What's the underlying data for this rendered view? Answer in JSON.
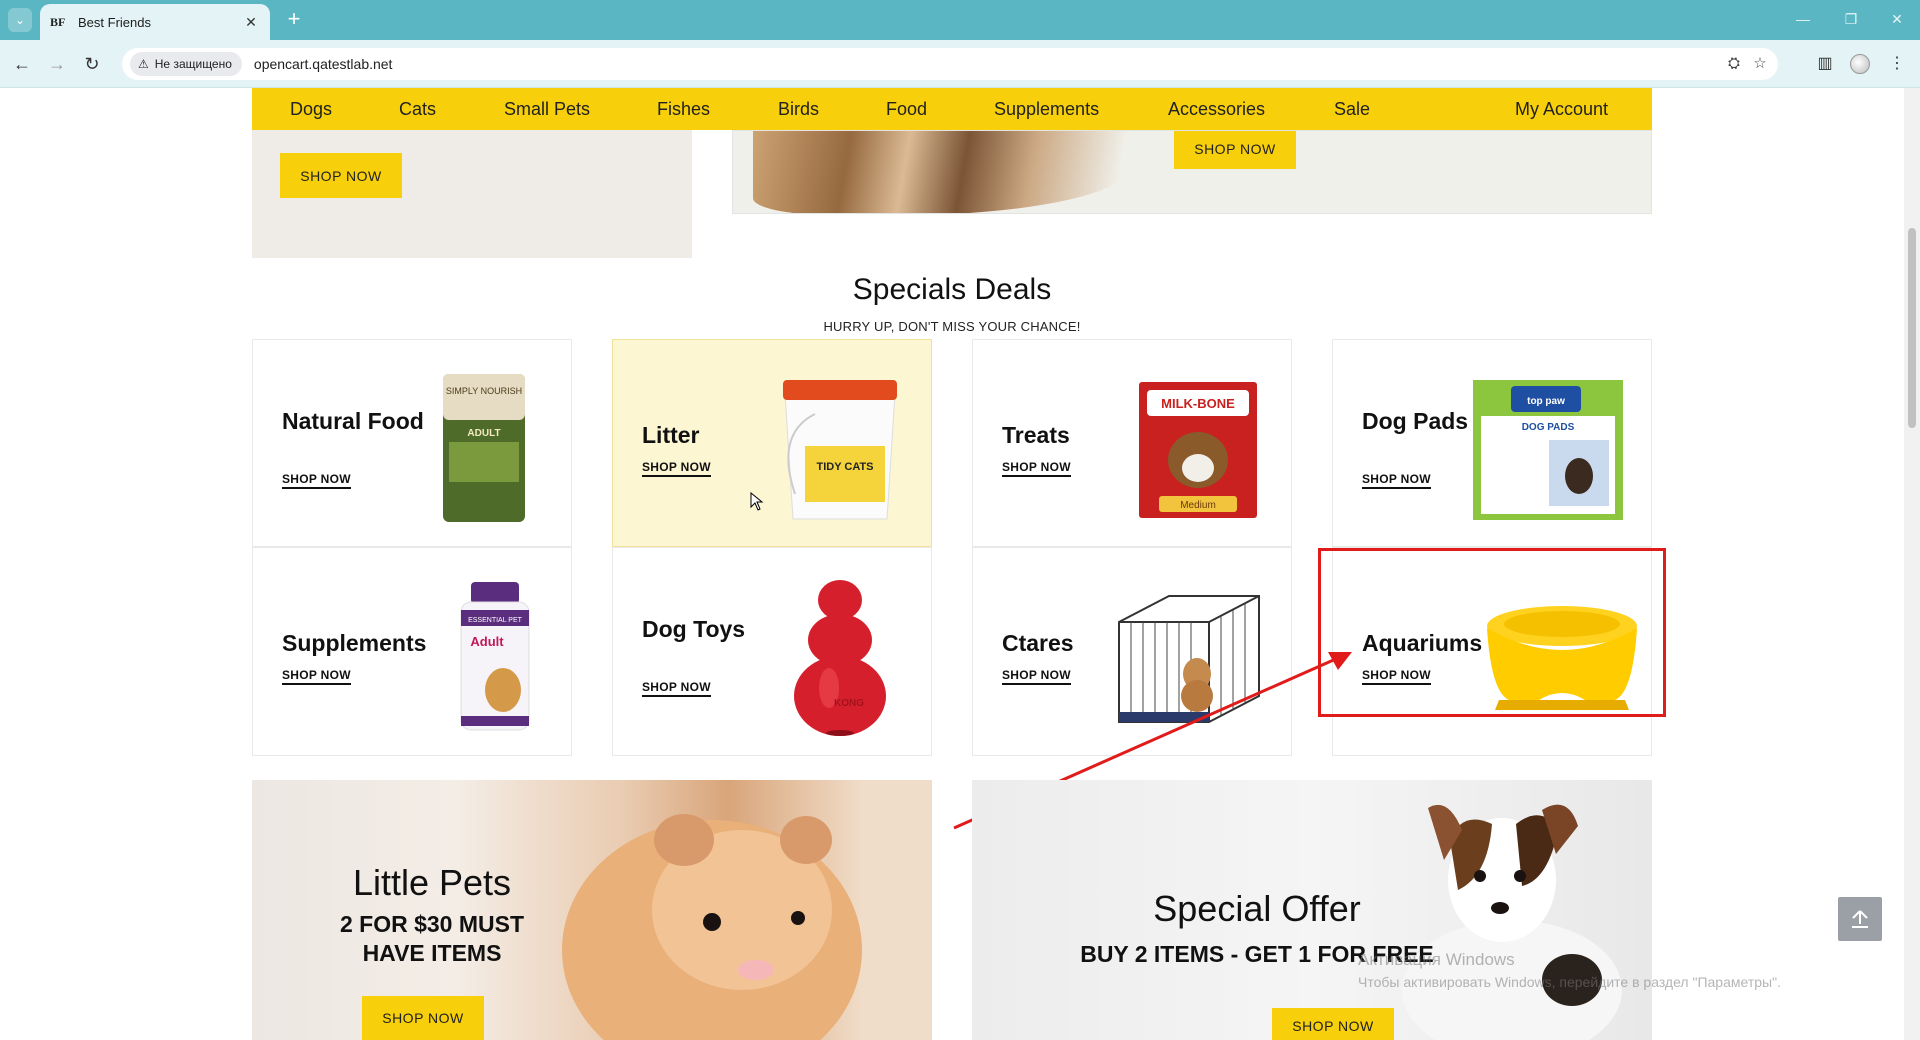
{
  "browser": {
    "tab_title": "Best Friends",
    "tab_favicon": "BF",
    "security_label": "Не защищено",
    "url": "opencart.qatestlab.net"
  },
  "nav": {
    "items": [
      "Dogs",
      "Cats",
      "Small Pets",
      "Fishes",
      "Birds",
      "Food",
      "Supplements",
      "Accessories",
      "Sale"
    ],
    "account": "My Account"
  },
  "top_promos": {
    "left_button": "SHOP NOW",
    "right_button": "SHOP NOW"
  },
  "specials": {
    "title": "Specials Deals",
    "subtitle": "HURRY UP, DON'T MISS YOUR CHANCE!",
    "cards": [
      {
        "title": "Natural Food",
        "link": "SHOP NOW"
      },
      {
        "title": "Litter",
        "link": "SHOP NOW"
      },
      {
        "title": "Treats",
        "link": "SHOP NOW"
      },
      {
        "title": "Dog Pads",
        "link": "SHOP NOW"
      },
      {
        "title": "Supplements",
        "link": "SHOP NOW"
      },
      {
        "title": "Dog Toys",
        "link": "SHOP NOW"
      },
      {
        "title": "Ctares",
        "link": "SHOP NOW"
      },
      {
        "title": "Aquariums",
        "link": "SHOP NOW"
      }
    ]
  },
  "product_labels": {
    "food_bag": "SIMPLY NOURISH",
    "food_bag_sub": "ADULT",
    "litter": "TIDY CATS",
    "treats": "MILK-BONE",
    "treats_sub": "Medium",
    "pads_brand": "top paw",
    "pads": "DOG PADS",
    "supplement_brand": "ESSENTIAL PET",
    "supplement": "Adult",
    "kong": "KONG"
  },
  "banners": {
    "left_title": "Little Pets",
    "left_sub": "2 FOR $30 MUST HAVE ITEMS",
    "left_button": "SHOP NOW",
    "right_title": "Special Offer",
    "right_sub": "BUY 2 ITEMS - GET 1 FOR FREE",
    "right_button": "SHOP NOW"
  },
  "watermark": {
    "line1": "Активация Windows",
    "line2": "Чтобы активировать Windows, перейдите в раздел \"Параметры\"."
  },
  "colors": {
    "accent": "#f7cf0a",
    "chrome": "#5bb6c3",
    "annotation": "#e11a1a"
  }
}
